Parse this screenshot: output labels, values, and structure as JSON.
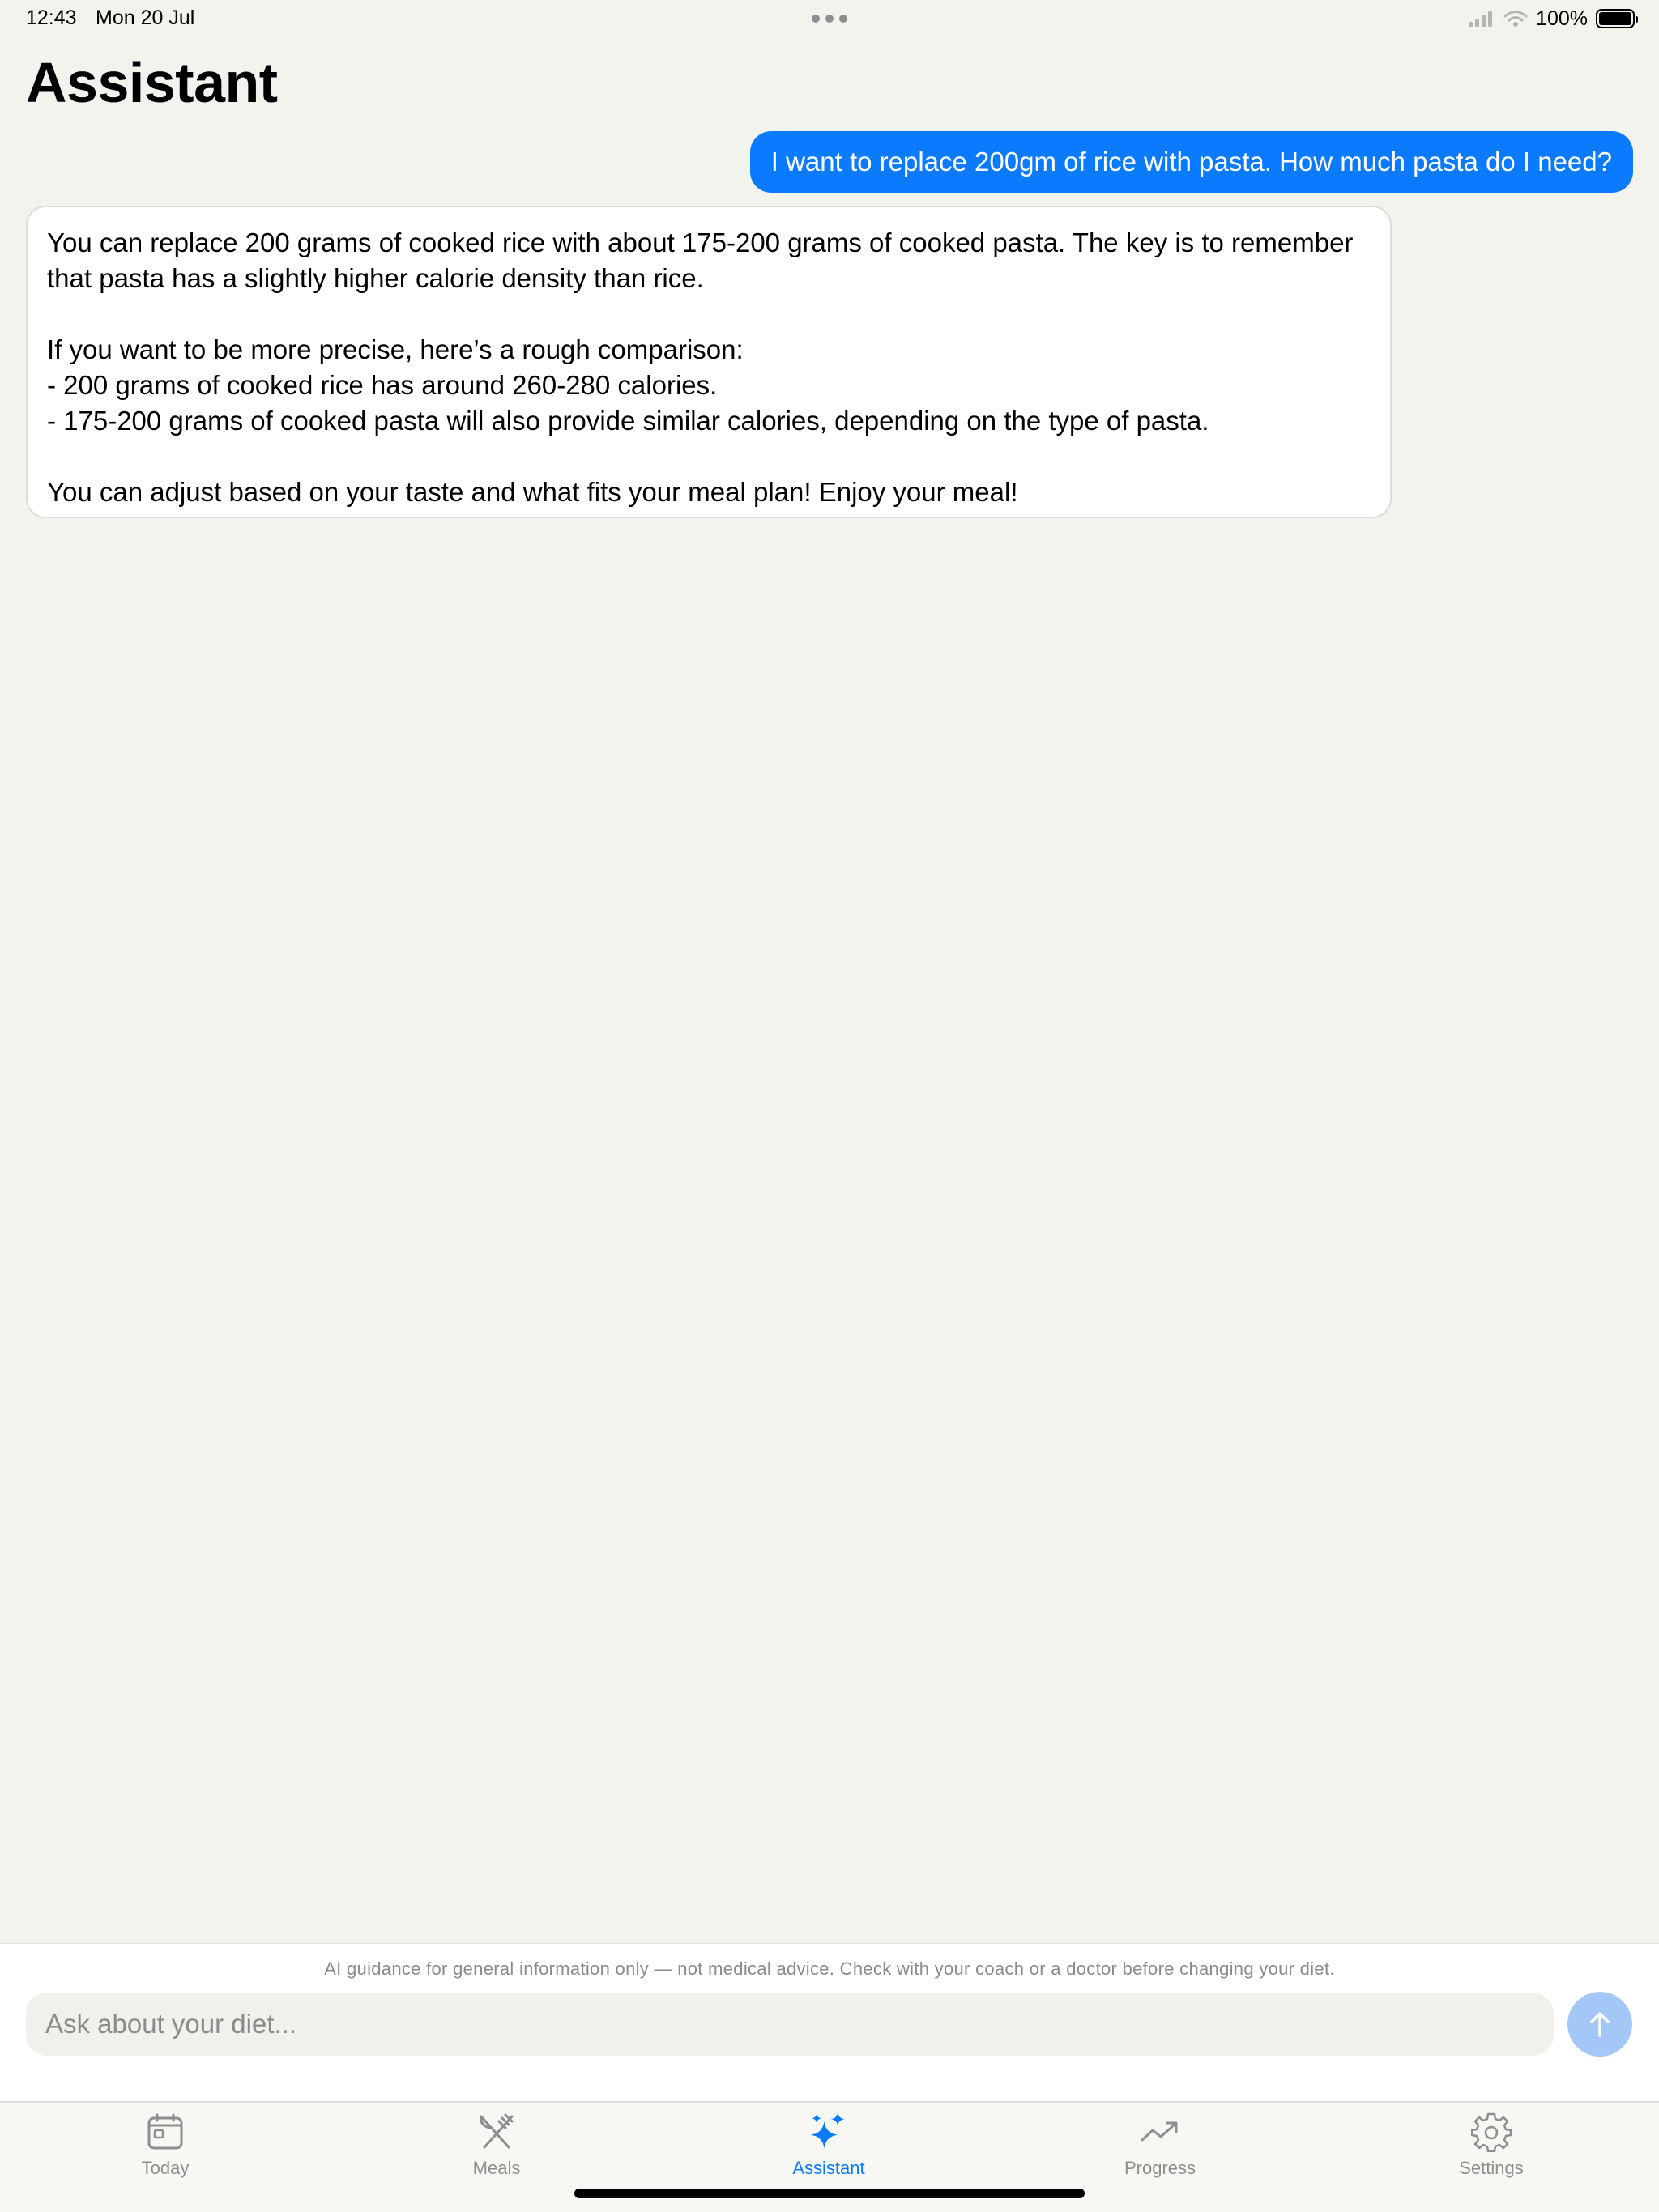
{
  "status_bar": {
    "time": "12:43",
    "date": "Mon 20 Jul",
    "battery": "100%",
    "battery_level": 1.0,
    "icons": [
      "signal-icon",
      "wifi-icon",
      "battery-icon"
    ]
  },
  "page": {
    "title": "Assistant"
  },
  "messages": {
    "user": "I want to replace 200gm of rice with pasta. How much pasta do I need?",
    "assistant": "You can replace 200 grams of cooked rice with about 175-200 grams of cooked pasta. The key is to remember that pasta has a slightly higher calorie density than rice.\n\nIf you want to be more precise, here’s a rough comparison:\n- 200 grams of cooked rice has around 260-280 calories.\n- 175-200 grams of cooked pasta will also provide similar calories, depending on the type of pasta.\n\nYou can adjust based on your taste and what fits your meal plan! Enjoy your meal!"
  },
  "composer": {
    "disclaimer": "AI guidance for general information only — not medical advice. Check with your coach or a doctor before changing your diet.",
    "placeholder": "Ask about your diet...",
    "value": "",
    "send_icon": "arrow-up-icon"
  },
  "tabs": [
    {
      "label": "Today",
      "icon": "calendar-icon",
      "active": false
    },
    {
      "label": "Meals",
      "icon": "fork-knife-icon",
      "active": false
    },
    {
      "label": "Assistant",
      "icon": "sparkles-icon",
      "active": true
    },
    {
      "label": "Progress",
      "icon": "trend-up-icon",
      "active": false
    },
    {
      "label": "Settings",
      "icon": "gear-icon",
      "active": false
    }
  ],
  "colors": {
    "accent": "#0a7aff",
    "background": "#f3f3ee",
    "inactive_tab": "#8e8e8e"
  }
}
